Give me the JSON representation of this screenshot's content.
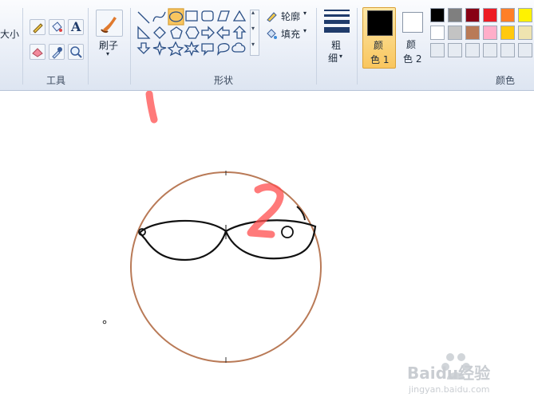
{
  "ribbon": {
    "size_label": "大小",
    "tools_label": "工具",
    "brush_label": "刷子",
    "shapes_label": "形状",
    "outline_label": "轮廓",
    "fill_label": "填充",
    "thickness_label_1": "粗",
    "thickness_label_2": "细",
    "color1_label_1": "颜",
    "color1_label_2": "色 1",
    "color2_label_1": "颜",
    "color2_label_2": "色 2",
    "colors_label": "颜色"
  },
  "palette_row1": [
    "#000000",
    "#7f7f7f",
    "#880015",
    "#ed1c24",
    "#ff7f27",
    "#fff200"
  ],
  "palette_row2": [
    "#ffffff",
    "#c3c3c3",
    "#b97a57",
    "#ffaec9",
    "#ffc90e",
    "#efe4b0"
  ],
  "annotations": {
    "mark_1": "1",
    "mark_2": "2"
  },
  "watermark": {
    "brand": "Baidu经验",
    "url": "jingyan.baidu.com"
  },
  "accent": {
    "selected_tool": "#f9c65f",
    "circle_stroke": "#b97a57",
    "annotation_red": "#ff4d4d"
  }
}
